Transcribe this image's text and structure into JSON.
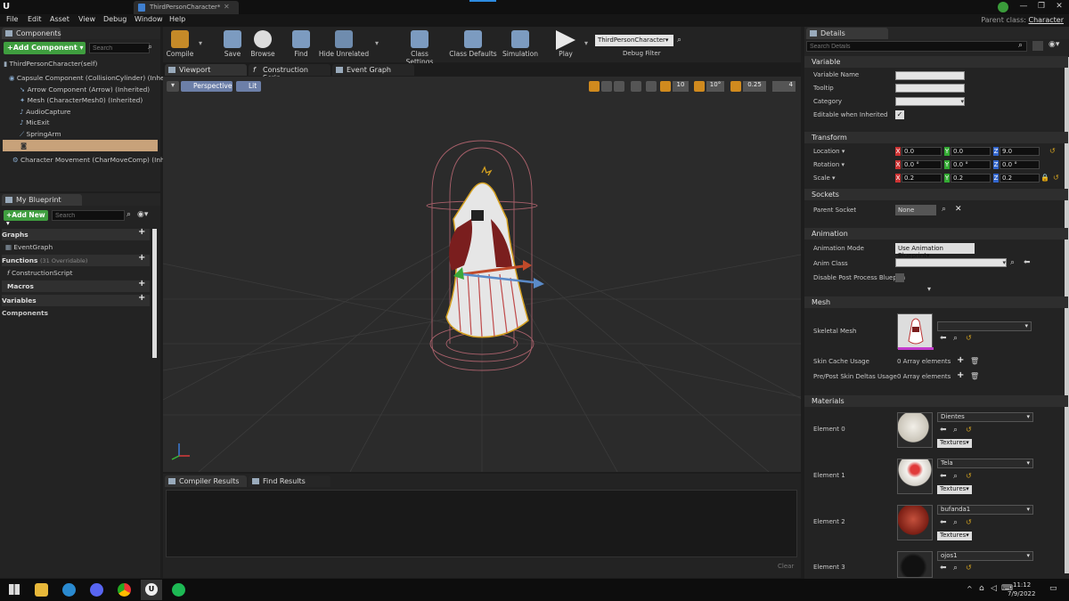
{
  "titlebar": {
    "tab_title": "ThirdPersonCharacter*",
    "logo": "U"
  },
  "menu": [
    "File",
    "Edit",
    "Asset",
    "View",
    "Debug",
    "Window",
    "Help"
  ],
  "parent_class": {
    "label": "Parent class:",
    "value": "Character"
  },
  "components_panel": {
    "tab": "Components",
    "add_button": "+Add Component ▾",
    "search_placeholder": "Search",
    "root": "ThirdPersonCharacter(self)",
    "items": [
      "Capsule Component (CollisionCylinder) (Inher",
      "Arrow Component (Arrow) (Inherited)",
      "Mesh (CharacterMesh0) (Inherited)",
      "AudioCapture",
      "MicExit",
      "SpringArm",
      "",
      "Character Movement (CharMoveComp) (Inhe"
    ]
  },
  "my_blueprint": {
    "tab": "My Blueprint",
    "add_button": "+Add New ▾",
    "search_placeholder": "Search",
    "graphs": "Graphs",
    "event_graph": "EventGraph",
    "functions": "Functions",
    "functions_count": "(31 Overridable)",
    "construction_script": "ConstructionScript",
    "macros": "Macros",
    "variables": "Variables",
    "components": "Components"
  },
  "toolbar": {
    "compile": "Compile",
    "save": "Save",
    "browse": "Browse",
    "find": "Find",
    "hide_unrelated": "Hide Unrelated",
    "class_settings": "Class Settings",
    "class_defaults": "Class Defaults",
    "simulation": "Simulation",
    "play": "Play",
    "debug_object": "ThirdPersonCharacter▾",
    "debug_filter": "Debug Filter"
  },
  "editor_tabs": [
    "Viewport",
    "Construction Scrip",
    "Event Graph"
  ],
  "viewport": {
    "perspective": "Perspective",
    "lit": "Lit",
    "grid_snap": "10",
    "rot_snap": "10°",
    "scale_snap": "0.25",
    "cam_speed": "4"
  },
  "bottom_tabs": [
    "Compiler Results",
    "Find Results"
  ],
  "clear_label": "Clear",
  "details": {
    "tab": "Details",
    "search_placeholder": "Search Details",
    "variable_section": "Variable",
    "variable_rows": [
      "Variable Name",
      "Tooltip",
      "Category",
      "Editable when Inherited"
    ],
    "transform_section": "Transform",
    "location_label": "Location ▾",
    "rotation_label": "Rotation ▾",
    "scale_label": "Scale ▾",
    "location": [
      "0.0",
      "0.0",
      "9.0"
    ],
    "rotation": [
      "0.0 °",
      "0.0 °",
      "0.0 °"
    ],
    "scale": [
      "0.2",
      "0.2",
      "0.2"
    ],
    "sockets_section": "Sockets",
    "parent_socket_label": "Parent Socket",
    "parent_socket_value": "None",
    "animation_section": "Animation",
    "animation_mode_label": "Animation Mode",
    "animation_mode_value": "Use Animation Blueprint▾",
    "anim_class_label": "Anim Class",
    "disable_post_label": "Disable Post Process Blueprin",
    "mesh_section": "Mesh",
    "skeletal_mesh_label": "Skeletal Mesh",
    "skin_cache_label": "Skin Cache Usage",
    "skin_cache_value": "0 Array elements",
    "skin_deltas_label": "Pre/Post Skin Deltas Usage",
    "skin_deltas_value": "0 Array elements",
    "materials_section": "Materials",
    "materials": [
      {
        "label": "Element 0",
        "name": "Dientes",
        "btn": "Textures▾"
      },
      {
        "label": "Element 1",
        "name": "Tela",
        "btn": "Textures▾"
      },
      {
        "label": "Element 2",
        "name": "bufanda1",
        "btn": "Textures▾"
      },
      {
        "label": "Element 3",
        "name": "ojos1",
        "btn": ""
      }
    ]
  },
  "taskbar": {
    "time": "11:12",
    "date": "7/9/2022"
  },
  "colors": {
    "accent_green": "#4aa84a",
    "accent_orange": "#d08a1e",
    "selected_row": "#c8a27a"
  }
}
